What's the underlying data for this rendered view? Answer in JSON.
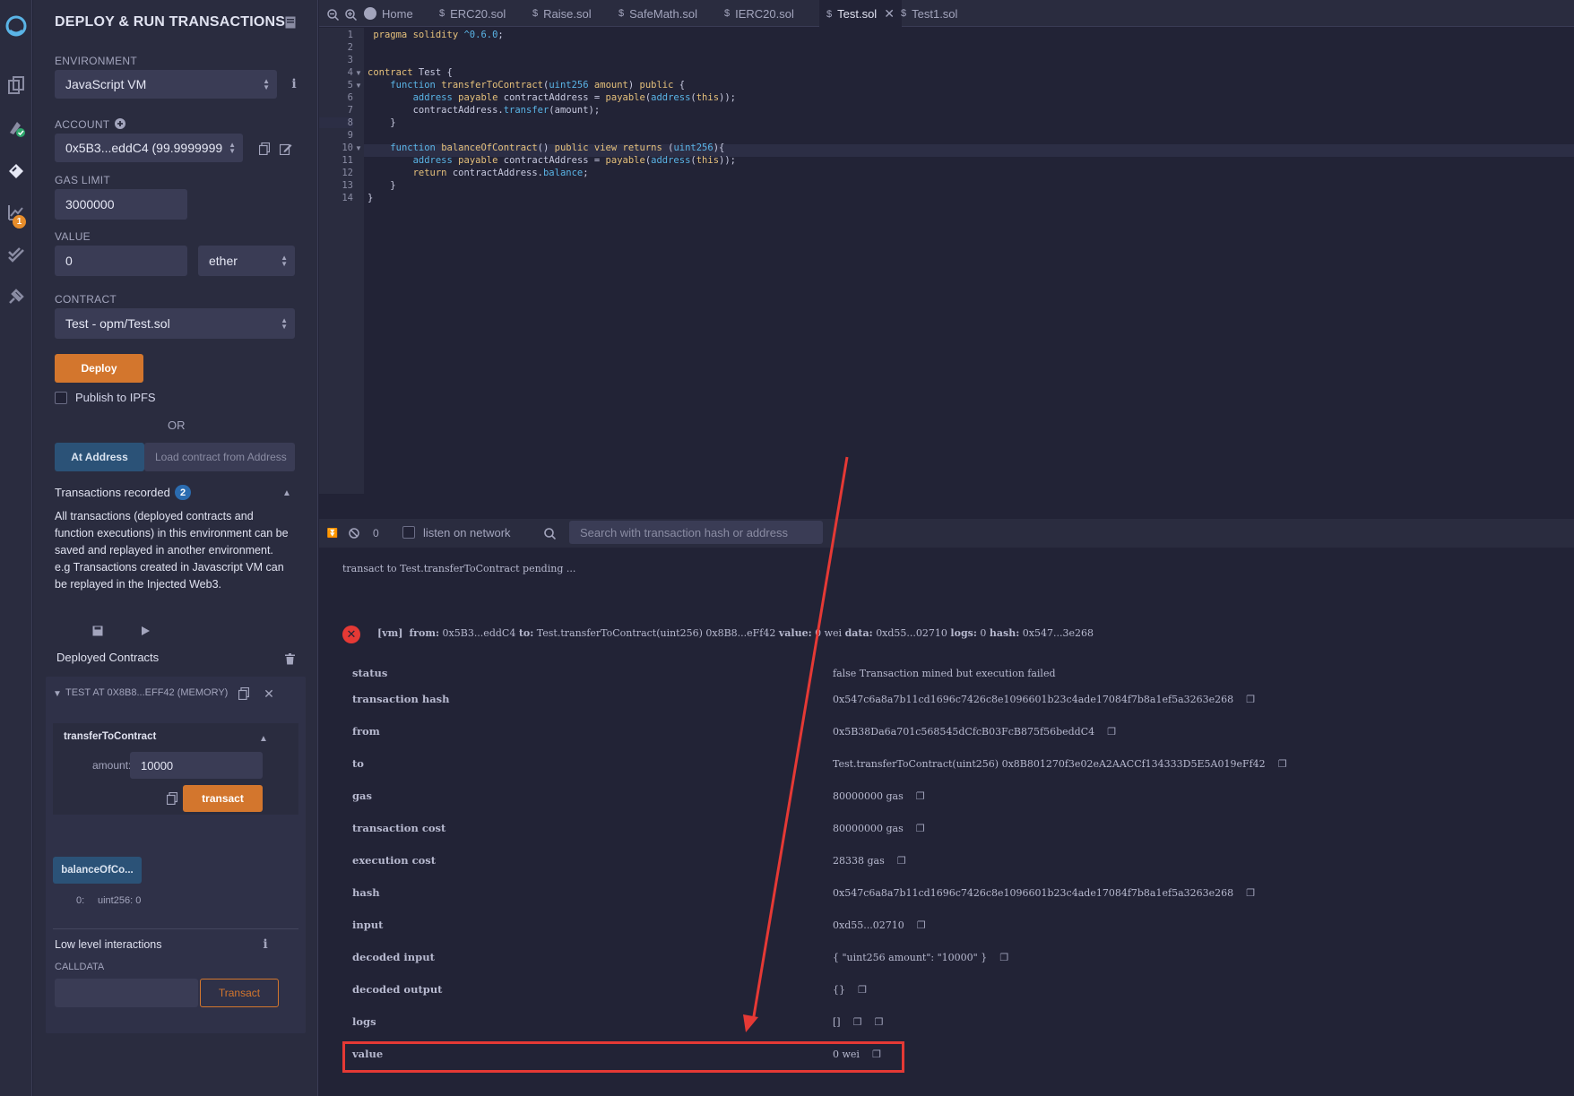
{
  "rail": {
    "icons": [
      "remix-logo-icon",
      "file-explorer-icon",
      "compiler-icon",
      "deploy-run-icon",
      "analysis-icon",
      "testing-icon",
      "plugin-manager-icon"
    ],
    "analysis_badge": "1"
  },
  "panel": {
    "title": "DEPLOY & RUN TRANSACTIONS",
    "environment_label": "ENVIRONMENT",
    "environment_value": "JavaScript VM",
    "account_label": "ACCOUNT",
    "account_value": "0x5B3...eddC4 (99.9999999",
    "gas_limit_label": "GAS LIMIT",
    "gas_limit_value": "3000000",
    "value_label": "VALUE",
    "value_amount": "0",
    "value_unit": "ether",
    "contract_label": "CONTRACT",
    "contract_value": "Test - opm/Test.sol",
    "deploy_label": "Deploy",
    "publish_ipfs_label": "Publish to IPFS",
    "or_label": "OR",
    "at_address_label": "At Address",
    "load_contract_placeholder": "Load contract from Address",
    "transactions_recorded_label": "Transactions recorded",
    "transactions_recorded_count": "2",
    "transactions_description": "All transactions (deployed contracts and function executions) in this environment can be saved and replayed in another environment. e.g Transactions created in Javascript VM can be replayed in the Injected Web3.",
    "deployed_contracts_label": "Deployed Contracts",
    "instance_title": "TEST AT 0X8B8...EFF42 (MEMORY)",
    "function_name": "transferToContract",
    "amount_label": "amount:",
    "amount_value": "10000",
    "transact_label": "transact",
    "balance_button_label": "balanceOfCo...",
    "balance_result_index": "0:",
    "balance_result_value": "uint256: 0",
    "low_level_label": "Low level interactions",
    "calldata_label": "CALLDATA",
    "low_level_transact_label": "Transact"
  },
  "tabs": [
    {
      "label": "Home",
      "active": false
    },
    {
      "label": "ERC20.sol",
      "active": false
    },
    {
      "label": "Raise.sol",
      "active": false
    },
    {
      "label": "SafeMath.sol",
      "active": false
    },
    {
      "label": "IERC20.sol",
      "active": false
    },
    {
      "label": "Test.sol",
      "active": true
    },
    {
      "label": "Test1.sol",
      "active": false
    }
  ],
  "editor": {
    "line_numbers": [
      "1",
      "2",
      "3",
      "4",
      "5",
      "6",
      "7",
      "8",
      "9",
      "10",
      "11",
      "12",
      "13",
      "14"
    ]
  },
  "terminal": {
    "pending_count": "0",
    "listen_label": "listen on network",
    "search_placeholder": "Search with transaction hash or address",
    "pending_message": "transact to Test.transferToContract pending ...",
    "summary": {
      "tag": "[vm]",
      "from_label": "from:",
      "from": "0x5B3...eddC4",
      "to_label": "to:",
      "to": "Test.transferToContract(uint256) 0x8B8...eFf42",
      "value_label": "value:",
      "value": "0 wei",
      "data_label": "data:",
      "data": "0xd55...02710",
      "logs_label": "logs:",
      "logs": "0",
      "hash_label": "hash:",
      "hash": "0x547...3e268"
    },
    "rows": [
      {
        "key": "status",
        "value": "false Transaction mined but execution failed"
      },
      {
        "key": "transaction hash",
        "value": "0x547c6a8a7b11cd1696c7426c8e1096601b23c4ade17084f7b8a1ef5a3263e268"
      },
      {
        "key": "from",
        "value": "0x5B38Da6a701c568545dCfcB03FcB875f56beddC4"
      },
      {
        "key": "to",
        "value": "Test.transferToContract(uint256) 0x8B801270f3e02eA2AACCf134333D5E5A019eFf42"
      },
      {
        "key": "gas",
        "value": "80000000 gas"
      },
      {
        "key": "transaction cost",
        "value": "80000000 gas"
      },
      {
        "key": "execution cost",
        "value": "28338 gas"
      },
      {
        "key": "hash",
        "value": "0x547c6a8a7b11cd1696c7426c8e1096601b23c4ade17084f7b8a1ef5a3263e268"
      },
      {
        "key": "input",
        "value": "0xd55...02710"
      },
      {
        "key": "decoded input",
        "value": "{ \"uint256 amount\": \"10000\" }"
      },
      {
        "key": "decoded output",
        "value": "{}"
      },
      {
        "key": "logs",
        "value": "[]"
      },
      {
        "key": "value",
        "value": "0 wei"
      }
    ]
  },
  "colors": {
    "accent_orange": "#d3762d",
    "accent_blue": "#2b5277",
    "annotation_red": "#e53935",
    "error_red": "#e53935"
  }
}
